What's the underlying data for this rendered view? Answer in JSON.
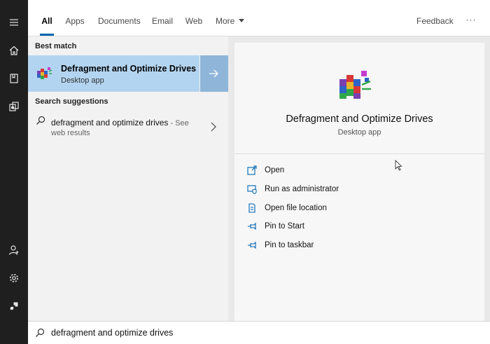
{
  "tabs": [
    {
      "label": "All",
      "active": true
    },
    {
      "label": "Apps"
    },
    {
      "label": "Documents"
    },
    {
      "label": "Email"
    },
    {
      "label": "Web"
    },
    {
      "label": "More"
    }
  ],
  "feedback_label": "Feedback",
  "more_options_label": "···",
  "rail_icons": [
    "menu-icon",
    "home-icon",
    "documents-icon",
    "collections-icon",
    "account-icon",
    "settings-icon",
    "power-icon"
  ],
  "results": {
    "best_match_header": "Best match",
    "best_match": {
      "title": "Defragment and Optimize Drives",
      "subtitle": "Desktop app"
    },
    "suggestions_header": "Search suggestions",
    "suggestion": {
      "query": "defragment and optimize drives",
      "see_label": " - See",
      "line2": "web results"
    }
  },
  "details": {
    "title": "Defragment and Optimize Drives",
    "subtitle": "Desktop app",
    "actions": [
      {
        "label": "Open",
        "icon": "open-icon"
      },
      {
        "label": "Run as administrator",
        "icon": "shield-admin-icon"
      },
      {
        "label": "Open file location",
        "icon": "file-location-icon"
      },
      {
        "label": "Pin to Start",
        "icon": "pin-icon"
      },
      {
        "label": "Pin to taskbar",
        "icon": "pin-icon"
      }
    ]
  },
  "search": {
    "value": "defragment and optimize drives"
  },
  "colors": {
    "accent": "#0063b1",
    "selection": "#b3d4f0",
    "rail": "#1f1f1f"
  }
}
